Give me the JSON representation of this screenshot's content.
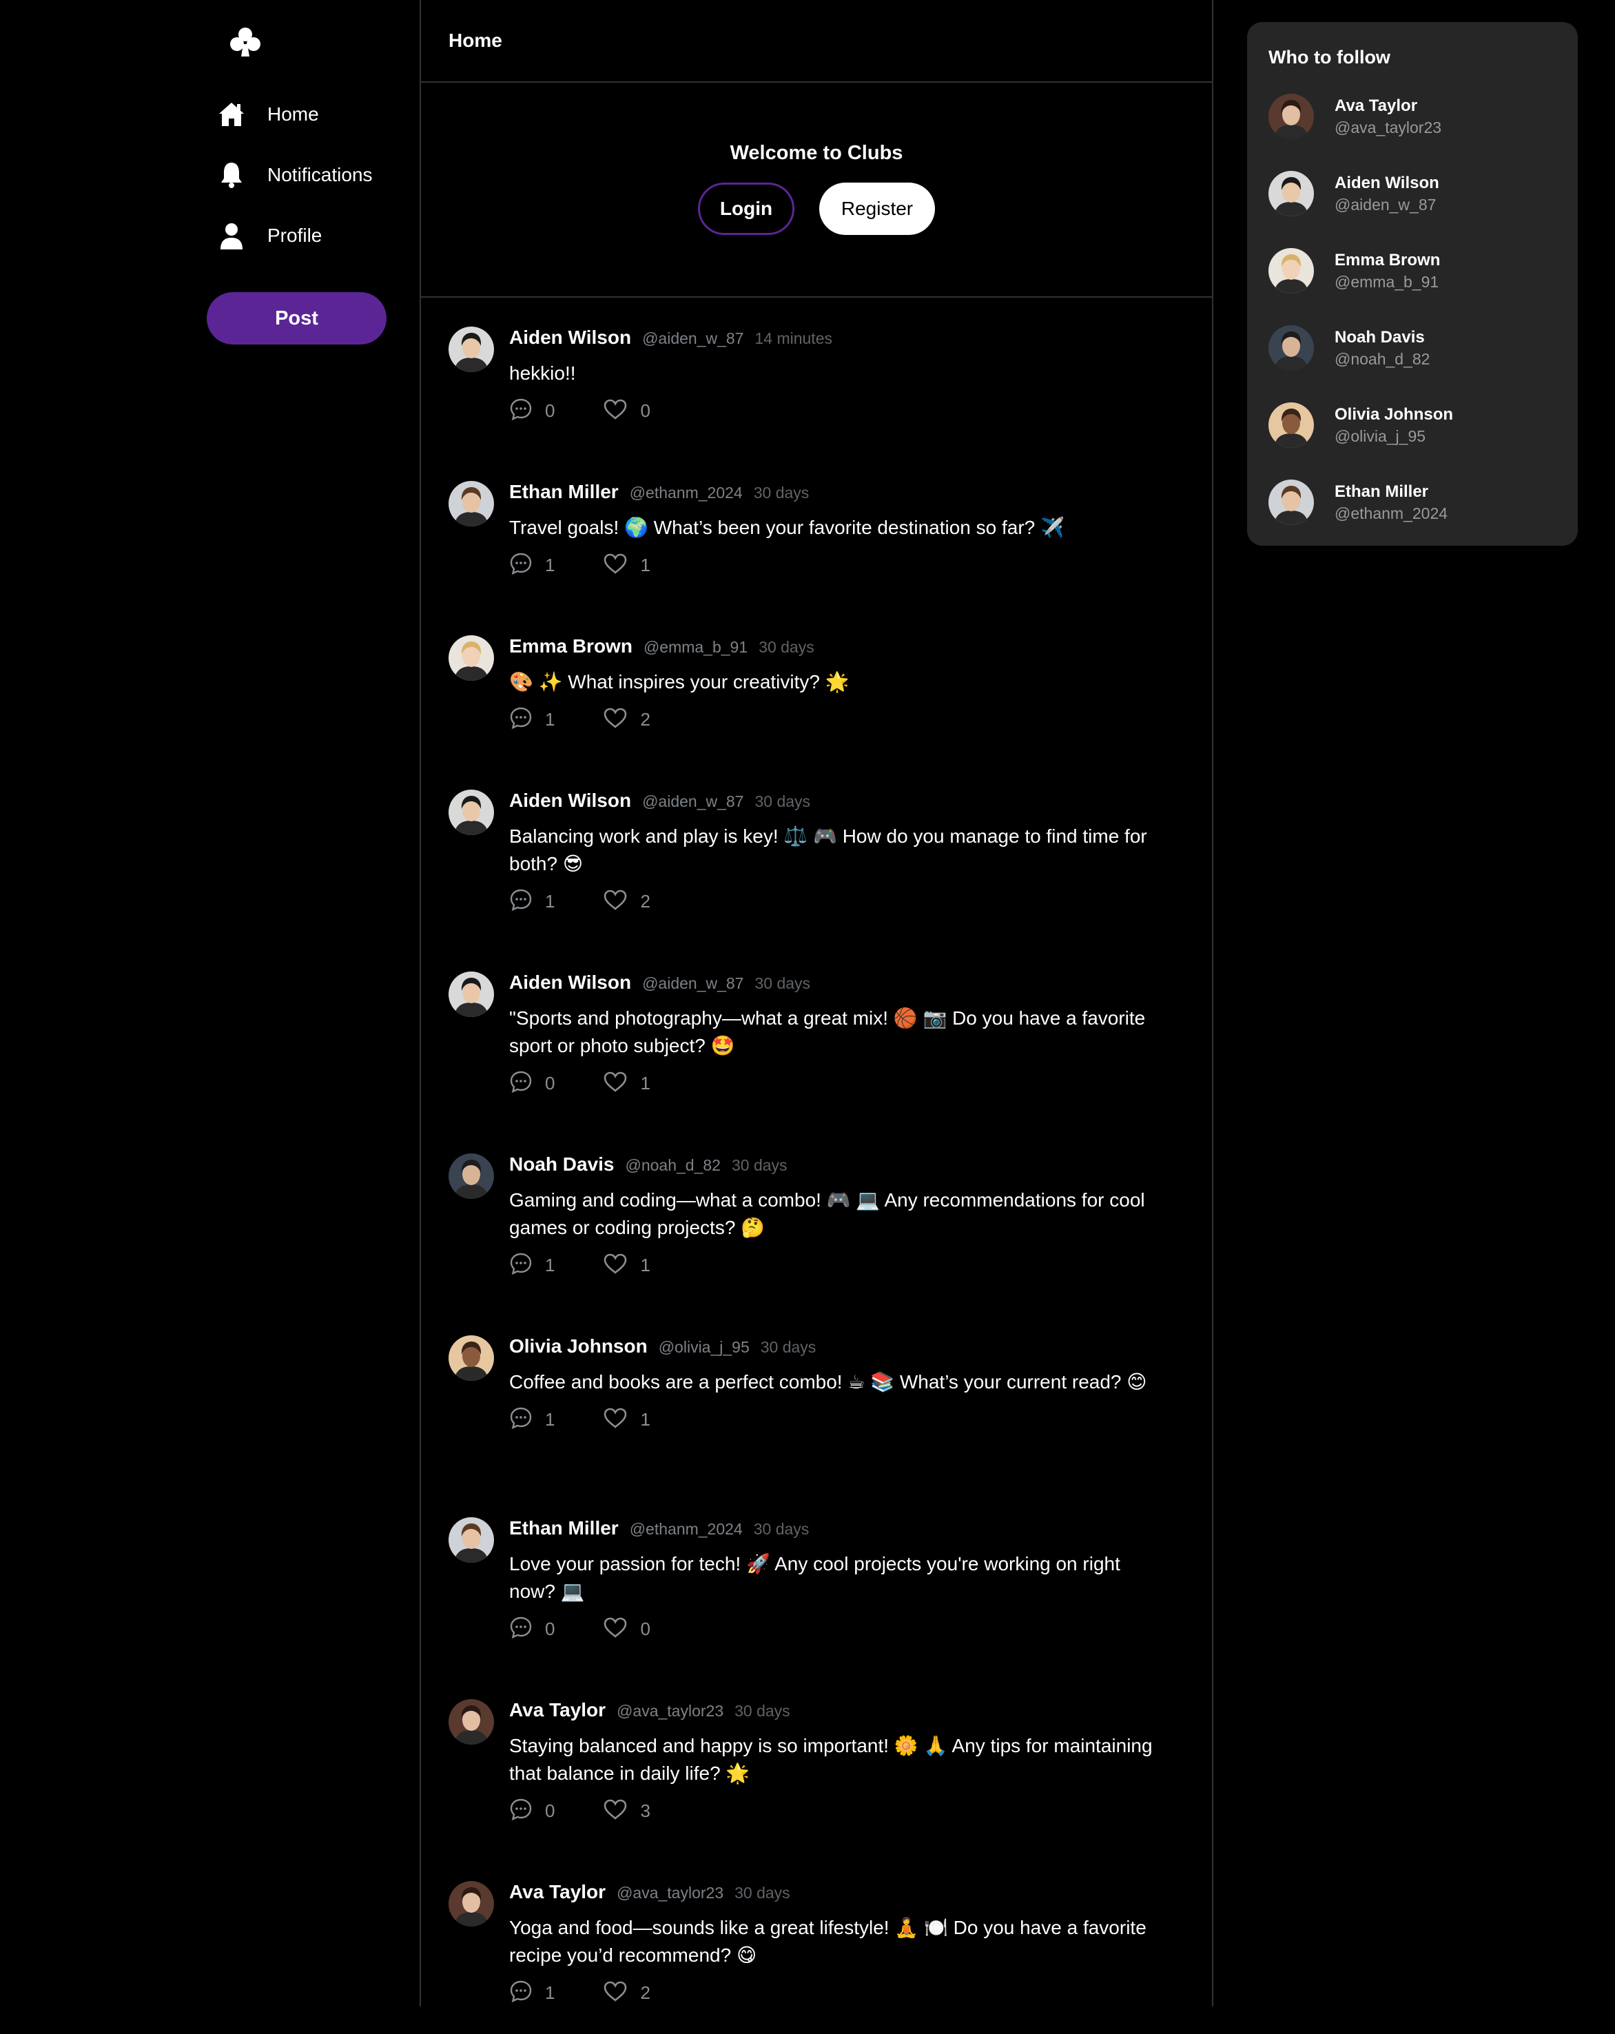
{
  "app": {
    "logo": "club-icon"
  },
  "nav": [
    {
      "label": "Home",
      "icon": "home-icon"
    },
    {
      "label": "Notifications",
      "icon": "bell-icon"
    },
    {
      "label": "Profile",
      "icon": "user-icon"
    }
  ],
  "post_button": "Post",
  "header": {
    "title": "Home"
  },
  "welcome": {
    "title": "Welcome to Clubs",
    "login": "Login",
    "register": "Register"
  },
  "posts": [
    {
      "name": "Aiden Wilson",
      "handle": "@aiden_w_87",
      "time": "14 minutes",
      "text": "hekkio!!",
      "comments": "0",
      "likes": "0"
    },
    {
      "name": "Ethan Miller",
      "handle": "@ethanm_2024",
      "time": "30 days",
      "text": "Travel goals! 🌍 What’s been your favorite destination so far? ✈️",
      "comments": "1",
      "likes": "1"
    },
    {
      "name": "Emma Brown",
      "handle": "@emma_b_91",
      "time": "30 days",
      "text": "🎨 ✨ What inspires your creativity? 🌟",
      "comments": "1",
      "likes": "2"
    },
    {
      "name": "Aiden Wilson",
      "handle": "@aiden_w_87",
      "time": "30 days",
      "text": "Balancing work and play is key! ⚖️ 🎮 How do you manage to find time for both? 😎",
      "comments": "1",
      "likes": "2"
    },
    {
      "name": "Aiden Wilson",
      "handle": "@aiden_w_87",
      "time": "30 days",
      "text": "\"Sports and photography—what a great mix! 🏀 📷 Do you have a favorite sport or photo subject? 🤩",
      "comments": "0",
      "likes": "1"
    },
    {
      "name": "Noah Davis",
      "handle": "@noah_d_82",
      "time": "30 days",
      "text": "Gaming and coding—what a combo! 🎮 💻 Any recommendations for cool games or coding projects? 🤔",
      "comments": "1",
      "likes": "1"
    },
    {
      "name": "Olivia Johnson",
      "handle": "@olivia_j_95",
      "time": "30 days",
      "text": "Coffee and books are a perfect combo! ☕ 📚 What’s your current read? 😊",
      "comments": "1",
      "likes": "1"
    },
    {
      "name": "Ethan Miller",
      "handle": "@ethanm_2024",
      "time": "30 days",
      "text": "Love your passion for tech! 🚀 Any cool projects you're working on right now? 💻",
      "comments": "0",
      "likes": "0"
    },
    {
      "name": "Ava Taylor",
      "handle": "@ava_taylor23",
      "time": "30 days",
      "text": "Staying balanced and happy is so important! 🌼 🙏 Any tips for maintaining that balance in daily life? 🌟",
      "comments": "0",
      "likes": "3"
    },
    {
      "name": "Ava Taylor",
      "handle": "@ava_taylor23",
      "time": "30 days",
      "text": "Yoga and food—sounds like a great lifestyle! 🧘 🍽️ Do you have a favorite recipe you’d recommend? 😋",
      "comments": "1",
      "likes": "2"
    }
  ],
  "who_to_follow": {
    "title": "Who to follow",
    "users": [
      {
        "name": "Ava Taylor",
        "handle": "@ava_taylor23"
      },
      {
        "name": "Aiden Wilson",
        "handle": "@aiden_w_87"
      },
      {
        "name": "Emma Brown",
        "handle": "@emma_b_91"
      },
      {
        "name": "Noah Davis",
        "handle": "@noah_d_82"
      },
      {
        "name": "Olivia Johnson",
        "handle": "@olivia_j_95"
      },
      {
        "name": "Ethan Miller",
        "handle": "@ethanm_2024"
      }
    ]
  }
}
